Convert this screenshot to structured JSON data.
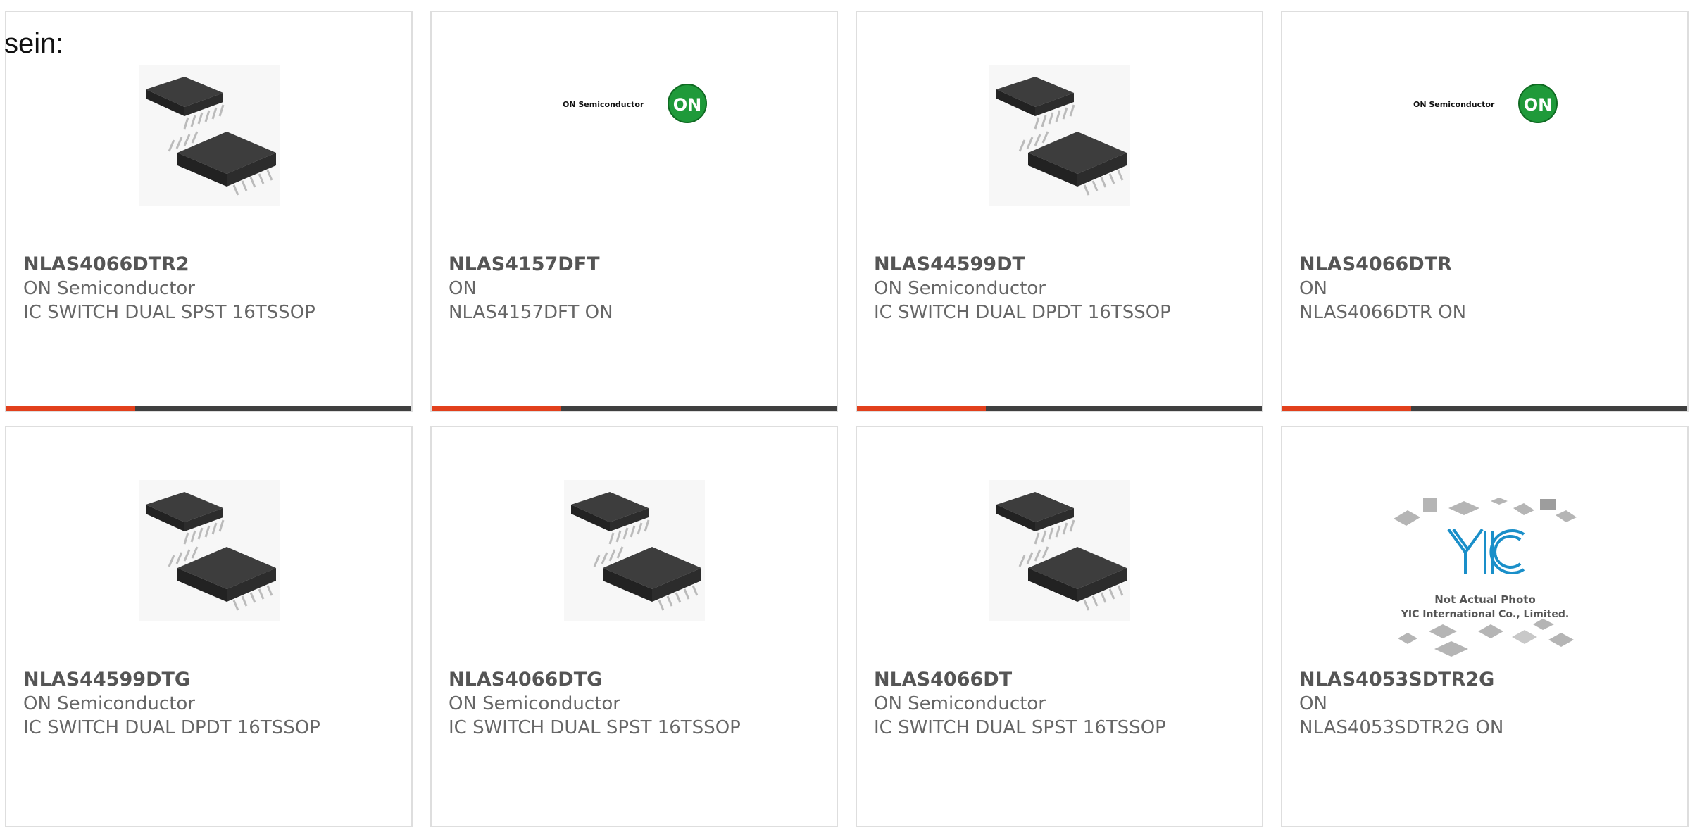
{
  "page": {
    "heading": "sein:"
  },
  "products": [
    {
      "part": "NLAS4066DTR2",
      "maker": "ON Semiconductor",
      "desc": "IC SWITCH DUAL SPST 16TSSOP",
      "image": "tssop-chip-image"
    },
    {
      "part": "NLAS4157DFT",
      "maker": "ON",
      "desc": "NLAS4157DFT ON",
      "image": "on-semiconductor-logo",
      "logo_text": "ON Semiconductor",
      "logo_badge": "ON"
    },
    {
      "part": "NLAS44599DT",
      "maker": "ON Semiconductor",
      "desc": "IC SWITCH DUAL DPDT 16TSSOP",
      "image": "tssop-chip-image"
    },
    {
      "part": "NLAS4066DTR",
      "maker": "ON",
      "desc": "NLAS4066DTR ON",
      "image": "on-semiconductor-logo",
      "logo_text": "ON Semiconductor",
      "logo_badge": "ON"
    },
    {
      "part": "NLAS44599DTG",
      "maker": "ON Semiconductor",
      "desc": "IC SWITCH DUAL DPDT 16TSSOP",
      "image": "tssop-chip-image"
    },
    {
      "part": "NLAS4066DTG",
      "maker": "ON Semiconductor",
      "desc": "IC SWITCH DUAL SPST 16TSSOP",
      "image": "tssop-chip-image"
    },
    {
      "part": "NLAS4066DT",
      "maker": "ON Semiconductor",
      "desc": "IC SWITCH DUAL SPST 16TSSOP",
      "image": "tssop-chip-image"
    },
    {
      "part": "NLAS4053SDTR2G",
      "maker": "ON",
      "desc": "NLAS4053SDTR2G ON",
      "image": "yic-placeholder-image",
      "logo_text": "YIC",
      "photo_note": "Not Actual Photo",
      "photo_company": "YIC International Co., Limited."
    }
  ],
  "colors": {
    "accent": "#e2401c",
    "bar": "#3f3f3f",
    "on_green": "#1f9a3a",
    "yic_blue": "#1a8fc9"
  }
}
